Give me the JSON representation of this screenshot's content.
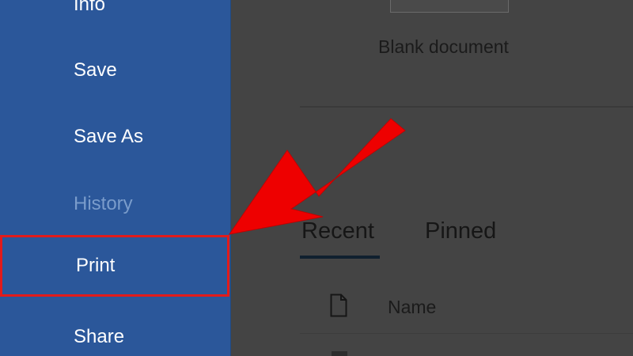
{
  "sidebar": {
    "items": [
      {
        "id": "info",
        "label": "Info"
      },
      {
        "id": "save",
        "label": "Save"
      },
      {
        "id": "saveas",
        "label": "Save As"
      },
      {
        "id": "history",
        "label": "History"
      },
      {
        "id": "print",
        "label": "Print"
      },
      {
        "id": "share",
        "label": "Share"
      }
    ]
  },
  "main": {
    "template_label": "Blank document",
    "tabs": [
      {
        "label": "Recent"
      },
      {
        "label": "Pinned"
      }
    ],
    "columns": {
      "name": "Name"
    }
  },
  "icons": {
    "file": "file-icon",
    "arrow": "red-arrow-annotation"
  },
  "colors": {
    "sidebar_bg": "#2b579a",
    "main_bg": "#444444",
    "annotation_red": "#e21b1b"
  }
}
